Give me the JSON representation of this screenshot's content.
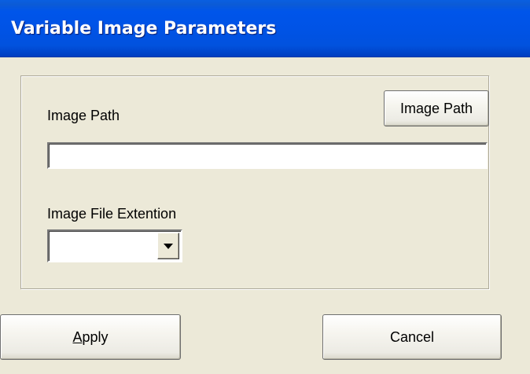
{
  "window": {
    "title": "Variable Image Parameters"
  },
  "image_path": {
    "label": "Image Path",
    "button_label": "Image Path",
    "value": ""
  },
  "extension": {
    "label": "Image File Extention",
    "selected_value": "",
    "dropdown_icon": "chevron-down-icon"
  },
  "actions": {
    "apply_label": "Apply",
    "apply_accelerator": "A",
    "cancel_label": "Cancel"
  },
  "colors": {
    "titlebar": "#0055ea",
    "window_background": "#ece9d8",
    "title_text": "#ffffff"
  }
}
